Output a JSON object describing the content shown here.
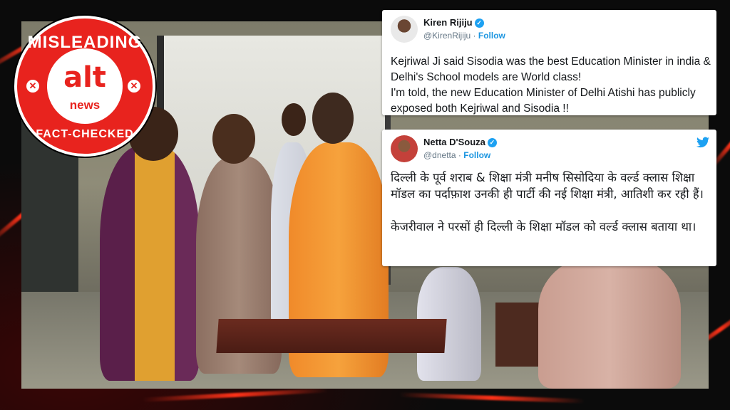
{
  "badge": {
    "top_text": "MISLEADING",
    "bottom_text": "FACT-CHECKED",
    "logo_main": "alt",
    "logo_sub": "news",
    "color": "#e8231e"
  },
  "tweets": [
    {
      "name": "Kiren Rijiju",
      "handle": "@KirenRijiju",
      "separator": "·",
      "follow_label": "Follow",
      "text": "Kejriwal Ji said Sisodia was the best Education Minister in india & Delhi's School models are World class!\nI'm told, the new Education Minister of Delhi Atishi has publicly exposed both Kejriwal and Sisodia !!"
    },
    {
      "name": "Netta D'Souza",
      "handle": "@dnetta",
      "separator": "·",
      "follow_label": "Follow",
      "icon": "twitter-bird-icon",
      "text": "दिल्ली के पूर्व शराब & शिक्षा मंत्री मनीष सिसोदिया के वर्ल्ड क्लास शिक्षा मॉडल का पर्दाफ़ाश उनकी ही पार्टी की नई शिक्षा मंत्री, आतिशी कर रही हैं।\n\nकेजरीवाल ने परसों ही दिल्ली के शिक्षा मॉडल को वर्ल्ड क्लास बताया था।"
    }
  ],
  "colors": {
    "twitter_blue": "#1da1f2",
    "accent_red": "#e8231e"
  }
}
